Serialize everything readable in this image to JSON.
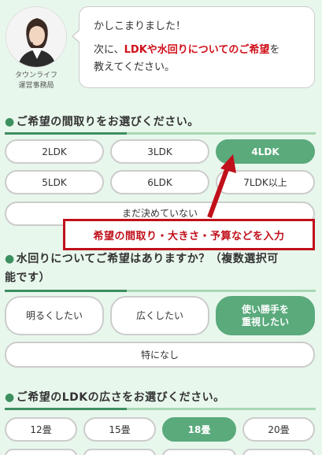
{
  "agent": {
    "name_line1": "タウンライフ",
    "name_line2": "運営事務局"
  },
  "bubble": {
    "line1": "かしこまりました！",
    "line2_pre": "次に、",
    "line2_hl": "LDKや水回りについてのご希望",
    "line2_post": "を",
    "line3": "教えてください。"
  },
  "q1": {
    "title": "ご希望の間取りをお選びください。",
    "options": [
      "2LDK",
      "3LDK",
      "4LDK",
      "5LDK",
      "6LDK",
      "7LDK以上",
      "まだ決めていない"
    ],
    "selected": "4LDK"
  },
  "callout": {
    "text": "希望の間取り・大きさ・予算などを入力"
  },
  "q2": {
    "title_line1": "水回りについてご希望はありますか？（複数選択可",
    "title_line2": "能です）",
    "options": [
      "明るくしたい",
      "広くしたい",
      "使い勝手を重視したい",
      "特になし"
    ],
    "option3_line1": "使い勝手を",
    "option3_line2": "重視したい",
    "selected": "使い勝手を重視したい"
  },
  "q3": {
    "title": "ご希望のLDKの広さをお選びください。",
    "options": [
      "12畳",
      "15畳",
      "18畳",
      "20畳"
    ],
    "selected": "18畳"
  },
  "colors": {
    "accent": "#5aaa7c",
    "highlight": "#d0101a",
    "background": "#e8f7ec"
  }
}
